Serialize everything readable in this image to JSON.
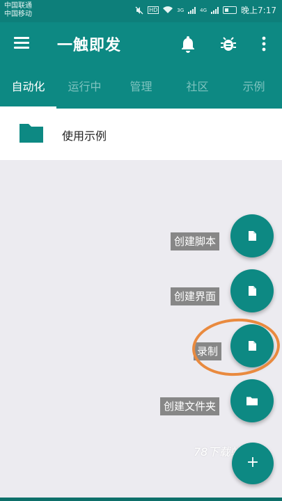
{
  "status_bar": {
    "carrier_1": "中国联通",
    "carrier_2": "中国移动",
    "network_1": "HD",
    "network_2": "3G",
    "network_3": "4G",
    "time": "晚上7:17"
  },
  "toolbar": {
    "title": "一触即发",
    "icons": [
      "menu-icon",
      "bell-icon",
      "bug-icon",
      "more-vert-icon"
    ]
  },
  "tabs": [
    {
      "label": "自动化",
      "active": true
    },
    {
      "label": "运行中",
      "active": false
    },
    {
      "label": "管理",
      "active": false
    },
    {
      "label": "社区",
      "active": false
    },
    {
      "label": "示例",
      "active": false
    }
  ],
  "list": {
    "items": [
      {
        "label": "使用示例",
        "icon": "folder-icon"
      }
    ]
  },
  "fab_menu": {
    "items": [
      {
        "label": "创建脚本",
        "icon": "file-icon"
      },
      {
        "label": "创建界面",
        "icon": "file-icon"
      },
      {
        "label": "录制",
        "icon": "file-icon"
      },
      {
        "label": "创建文件夹",
        "icon": "folder-icon"
      }
    ],
    "main_symbol": "+"
  },
  "watermark": "78下载站",
  "colors": {
    "primary": "#0d8983",
    "status_bar": "#0d7f7a",
    "background": "#ecebf0",
    "label_bg": "#878787",
    "highlight": "#e98a3f"
  }
}
